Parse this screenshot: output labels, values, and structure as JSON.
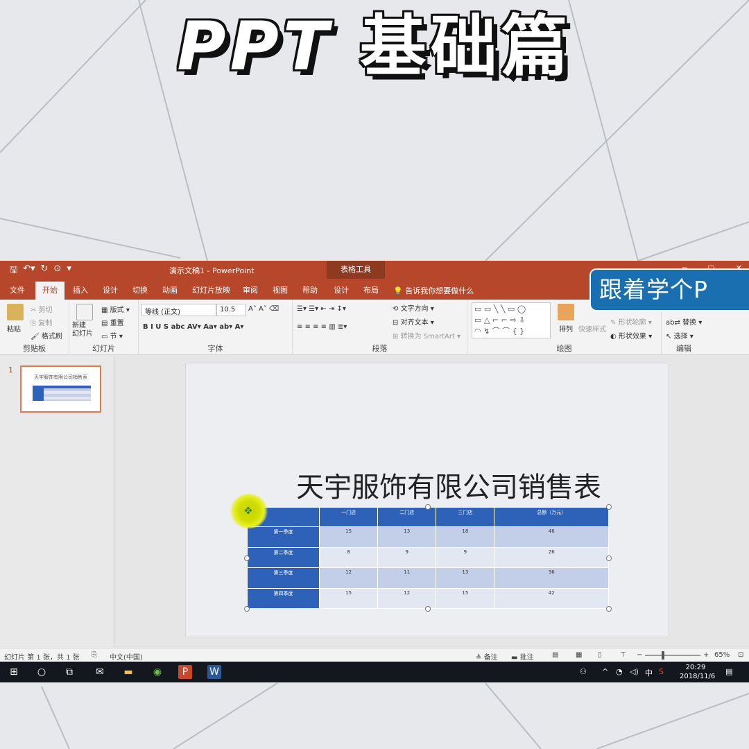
{
  "headline": {
    "latin": "PPT",
    "cjk": "基础篇"
  },
  "app": {
    "doc_title": "演示文稿1  -  PowerPoint",
    "contextual_tools": "表格工具",
    "tell_me": "告诉我你想要做什么",
    "tabs": [
      "文件",
      "开始",
      "插入",
      "设计",
      "切换",
      "动画",
      "幻灯片放映",
      "审阅",
      "视图",
      "帮助",
      "设计",
      "布局"
    ]
  },
  "ribbon": {
    "clipboard": {
      "paste": "粘贴",
      "cut": "剪切",
      "copy": "复制",
      "format_painter": "格式刷",
      "label": "剪贴板"
    },
    "slides": {
      "new_slide": "新建\n幻灯片",
      "layout": "版式",
      "reset": "重置",
      "section": "节",
      "label": "幻灯片"
    },
    "font": {
      "family": "等线 (正文)",
      "size": "10.5",
      "label": "字体"
    },
    "paragraph": {
      "text_direction": "文字方向",
      "align_text": "对齐文本",
      "smartart": "转换为 SmartArt",
      "label": "段落"
    },
    "drawing": {
      "arrange": "排列",
      "quick_styles": "快速样式",
      "shape_outline": "形状轮廓",
      "shape_effects": "形状效果",
      "label": "绘图"
    },
    "editing": {
      "replace": "替换",
      "select": "选择",
      "label": "编辑"
    }
  },
  "watermark": "跟着学个P",
  "slide_panel": {
    "slide_number": "1",
    "thumb_title": "天宇服饰有限公司销售表"
  },
  "slide": {
    "title": "天宇服饰有限公司销售表",
    "table": {
      "headers": [
        "",
        "一门店",
        "二门店",
        "三门店",
        "总额（万元）"
      ],
      "rows": [
        {
          "label": "第一季度",
          "values": [
            "15",
            "13",
            "18",
            "46"
          ]
        },
        {
          "label": "第二季度",
          "values": [
            "8",
            "9",
            "9",
            "26"
          ]
        },
        {
          "label": "第三季度",
          "values": [
            "12",
            "11",
            "13",
            "36"
          ]
        },
        {
          "label": "第四季度",
          "values": [
            "15",
            "12",
            "15",
            "42"
          ]
        }
      ]
    }
  },
  "status": {
    "slide_info": "幻灯片 第 1 张，共 1 张",
    "language": "中文(中国)",
    "notes": "备注",
    "comments": "批注",
    "zoom": "65%"
  },
  "taskbar": {
    "time": "20:29",
    "date": "2018/11/6",
    "ime": "中"
  }
}
